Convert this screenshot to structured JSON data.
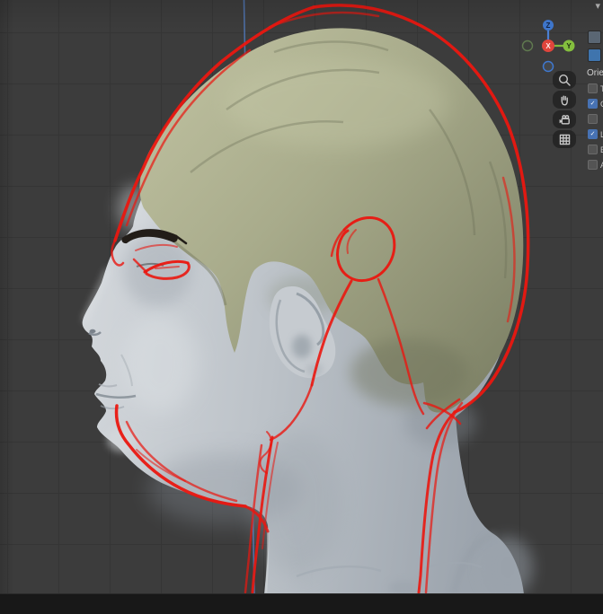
{
  "colors": {
    "viewport_bg": "#3c3c3c",
    "grid_line": "#353535",
    "annotation_red": "#ea1710",
    "axis_z_blue": "#4f74b0",
    "accent_blue": "#4772b3",
    "hair_green": "#a8ab8b",
    "skin_gray": "#bcc2c8",
    "bottom_bar": "#181818",
    "gizmo_x_red": "#e0453c",
    "gizmo_y_green": "#84bf3e",
    "gizmo_z_blue": "#3f78cf"
  },
  "gizmo": {
    "x_label": "X",
    "y_label": "Y",
    "z_label": "Z"
  },
  "nav_buttons": [
    {
      "icon": "magnifier-icon"
    },
    {
      "icon": "hand-icon"
    },
    {
      "icon": "camera-icon"
    },
    {
      "icon": "grid-icon"
    }
  ],
  "top_right": {
    "chevron": "▾"
  },
  "side_panel": {
    "title_partial": "Orie",
    "check_glyph": "✓",
    "swatches": [
      "#5a6673",
      "#3f74ad"
    ],
    "rows": [
      {
        "label": "T",
        "checked": false
      },
      {
        "label": "C",
        "checked": true
      },
      {
        "label": "",
        "checked": false
      },
      {
        "label": "L",
        "checked": true
      },
      {
        "label": "E",
        "checked": false
      },
      {
        "label": "A",
        "checked": false
      }
    ]
  }
}
